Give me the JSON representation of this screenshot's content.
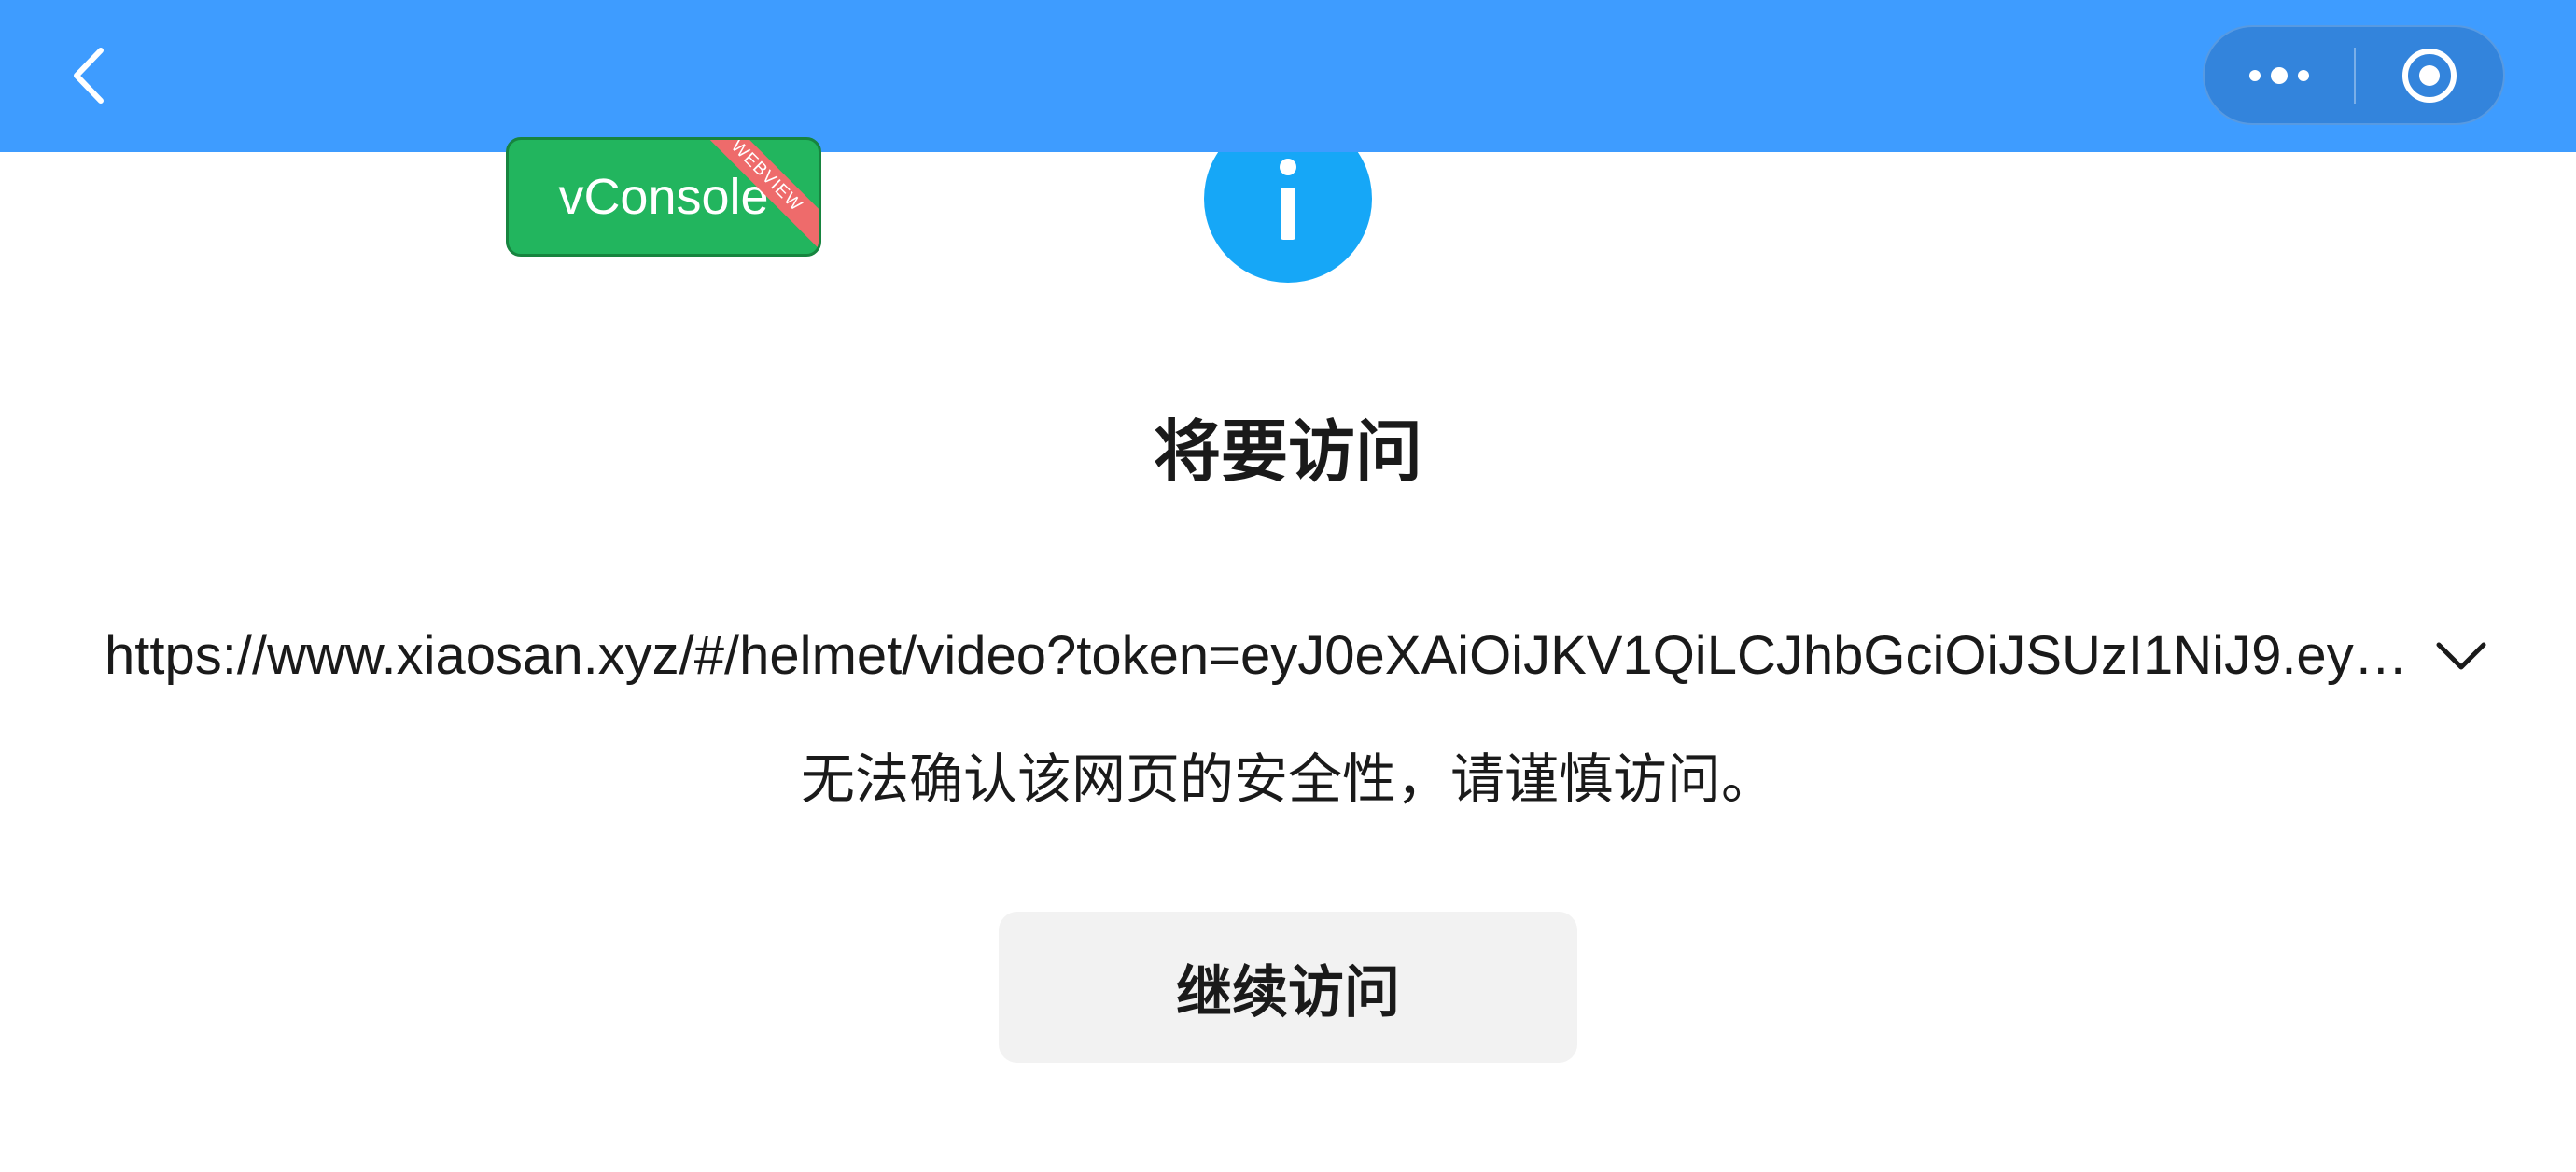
{
  "navbar": {
    "background_color": "#3e9cff",
    "back_icon": "chevron-left-icon",
    "more_icon": "more-dots-icon",
    "close_icon": "target-circle-icon"
  },
  "vconsole": {
    "label": "vConsole",
    "ribbon": "WEBVIEW",
    "color": "#22b55e"
  },
  "info_icon": {
    "icon": "info-icon",
    "glyph": "i",
    "color": "#16a7f7"
  },
  "dialog": {
    "title": "将要访问",
    "url": "https://www.xiaosan.xyz/#/helmet/video?token=eyJ0eXAiOiJKV1QiLCJhbGciOiJSUzI1NiJ9.eyJ…",
    "expand_icon": "chevron-down-icon",
    "warning": "无法确认该网页的安全性，请谨慎访问。",
    "continue_label": "继续访问"
  }
}
